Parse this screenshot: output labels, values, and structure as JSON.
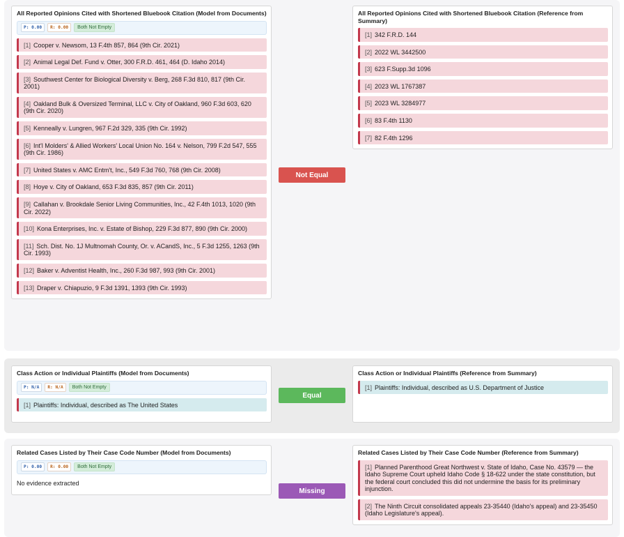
{
  "sections": [
    {
      "left": {
        "title": "All Reported Opinions Cited with Shortened Bluebook Citation (Model from Documents)",
        "p": "P: 0.00",
        "r": "R: 0.00",
        "status": "Both Not Empty",
        "items": [
          {
            "num": "[1]",
            "text": "Cooper v. Newsom, 13 F.4th 857, 864 (9th Cir. 2021)"
          },
          {
            "num": "[2]",
            "text": "Animal Legal Def. Fund v. Otter, 300 F.R.D. 461, 464 (D. Idaho 2014)"
          },
          {
            "num": "[3]",
            "text": "Southwest Center for Biological Diversity v. Berg, 268 F.3d 810, 817 (9th Cir. 2001)"
          },
          {
            "num": "[4]",
            "text": "Oakland Bulk & Oversized Terminal, LLC v. City of Oakland, 960 F.3d 603, 620 (9th Cir. 2020)"
          },
          {
            "num": "[5]",
            "text": "Kenneally v. Lungren, 967 F.2d 329, 335 (9th Cir. 1992)"
          },
          {
            "num": "[6]",
            "text": "Int'l Molders' & Allied Workers' Local Union No. 164 v. Nelson, 799 F.2d 547, 555 (9th Cir. 1986)"
          },
          {
            "num": "[7]",
            "text": "United States v. AMC Entm't, Inc., 549 F.3d 760, 768 (9th Cir. 2008)"
          },
          {
            "num": "[8]",
            "text": "Hoye v. City of Oakland, 653 F.3d 835, 857 (9th Cir. 2011)"
          },
          {
            "num": "[9]",
            "text": "Callahan v. Brookdale Senior Living Communities, Inc., 42 F.4th 1013, 1020 (9th Cir. 2022)"
          },
          {
            "num": "[10]",
            "text": "Kona Enterprises, Inc. v. Estate of Bishop, 229 F.3d 877, 890 (9th Cir. 2000)"
          },
          {
            "num": "[11]",
            "text": "Sch. Dist. No. 1J Multnomah County, Or. v. ACandS, Inc., 5 F.3d 1255, 1263 (9th Cir. 1993)"
          },
          {
            "num": "[12]",
            "text": "Baker v. Adventist Health, Inc., 260 F.3d 987, 993 (9th Cir. 2001)"
          },
          {
            "num": "[13]",
            "text": "Draper v. Chiapuzio, 9 F.3d 1391, 1393 (9th Cir. 1993)"
          }
        ]
      },
      "verdict": "Not Equal",
      "right": {
        "title": "All Reported Opinions Cited with Shortened Bluebook Citation (Reference from Summary)",
        "items": [
          {
            "num": "[1]",
            "text": "342 F.R.D. 144"
          },
          {
            "num": "[2]",
            "text": "2022 WL 3442500"
          },
          {
            "num": "[3]",
            "text": "623 F.Supp.3d 1096"
          },
          {
            "num": "[4]",
            "text": "2023 WL 1767387"
          },
          {
            "num": "[5]",
            "text": "2023 WL 3284977"
          },
          {
            "num": "[6]",
            "text": "83 F.4th 1130"
          },
          {
            "num": "[7]",
            "text": "82 F.4th 1296"
          }
        ]
      }
    },
    {
      "left": {
        "title": "Class Action or Individual Plaintiffs (Model from Documents)",
        "p": "P: N/A",
        "r": "R: N/A",
        "status": "Both Not Empty",
        "items": [
          {
            "num": "[1]",
            "text": "Plaintiffs: Individual, described as The United States"
          }
        ]
      },
      "verdict": "Equal",
      "right": {
        "title": "Class Action or Individual Plaintiffs (Reference from Summary)",
        "items": [
          {
            "num": "[1]",
            "text": "Plaintiffs: Individual, described as U.S. Department of Justice"
          }
        ]
      }
    },
    {
      "left": {
        "title": "Related Cases Listed by Their Case Code Number (Model from Documents)",
        "p": "P: 0.00",
        "r": "R: 0.00",
        "status": "Both Not Empty",
        "empty": "No evidence extracted"
      },
      "verdict": "Missing",
      "right": {
        "title": "Related Cases Listed by Their Case Code Number (Reference from Summary)",
        "items": [
          {
            "num": "[1]",
            "text": "Planned Parenthood Great Northwest v. State of Idaho, Case No. 43579 — the Idaho Supreme Court upheld Idaho Code § 18-622 under the state constitution, but the federal court concluded this did not undermine the basis for its preliminary injunction."
          },
          {
            "num": "[2]",
            "text": "The Ninth Circuit consolidated appeals 23-35440 (Idaho's appeal) and 23-35450 (Idaho Legislature's appeal)."
          }
        ]
      }
    }
  ]
}
